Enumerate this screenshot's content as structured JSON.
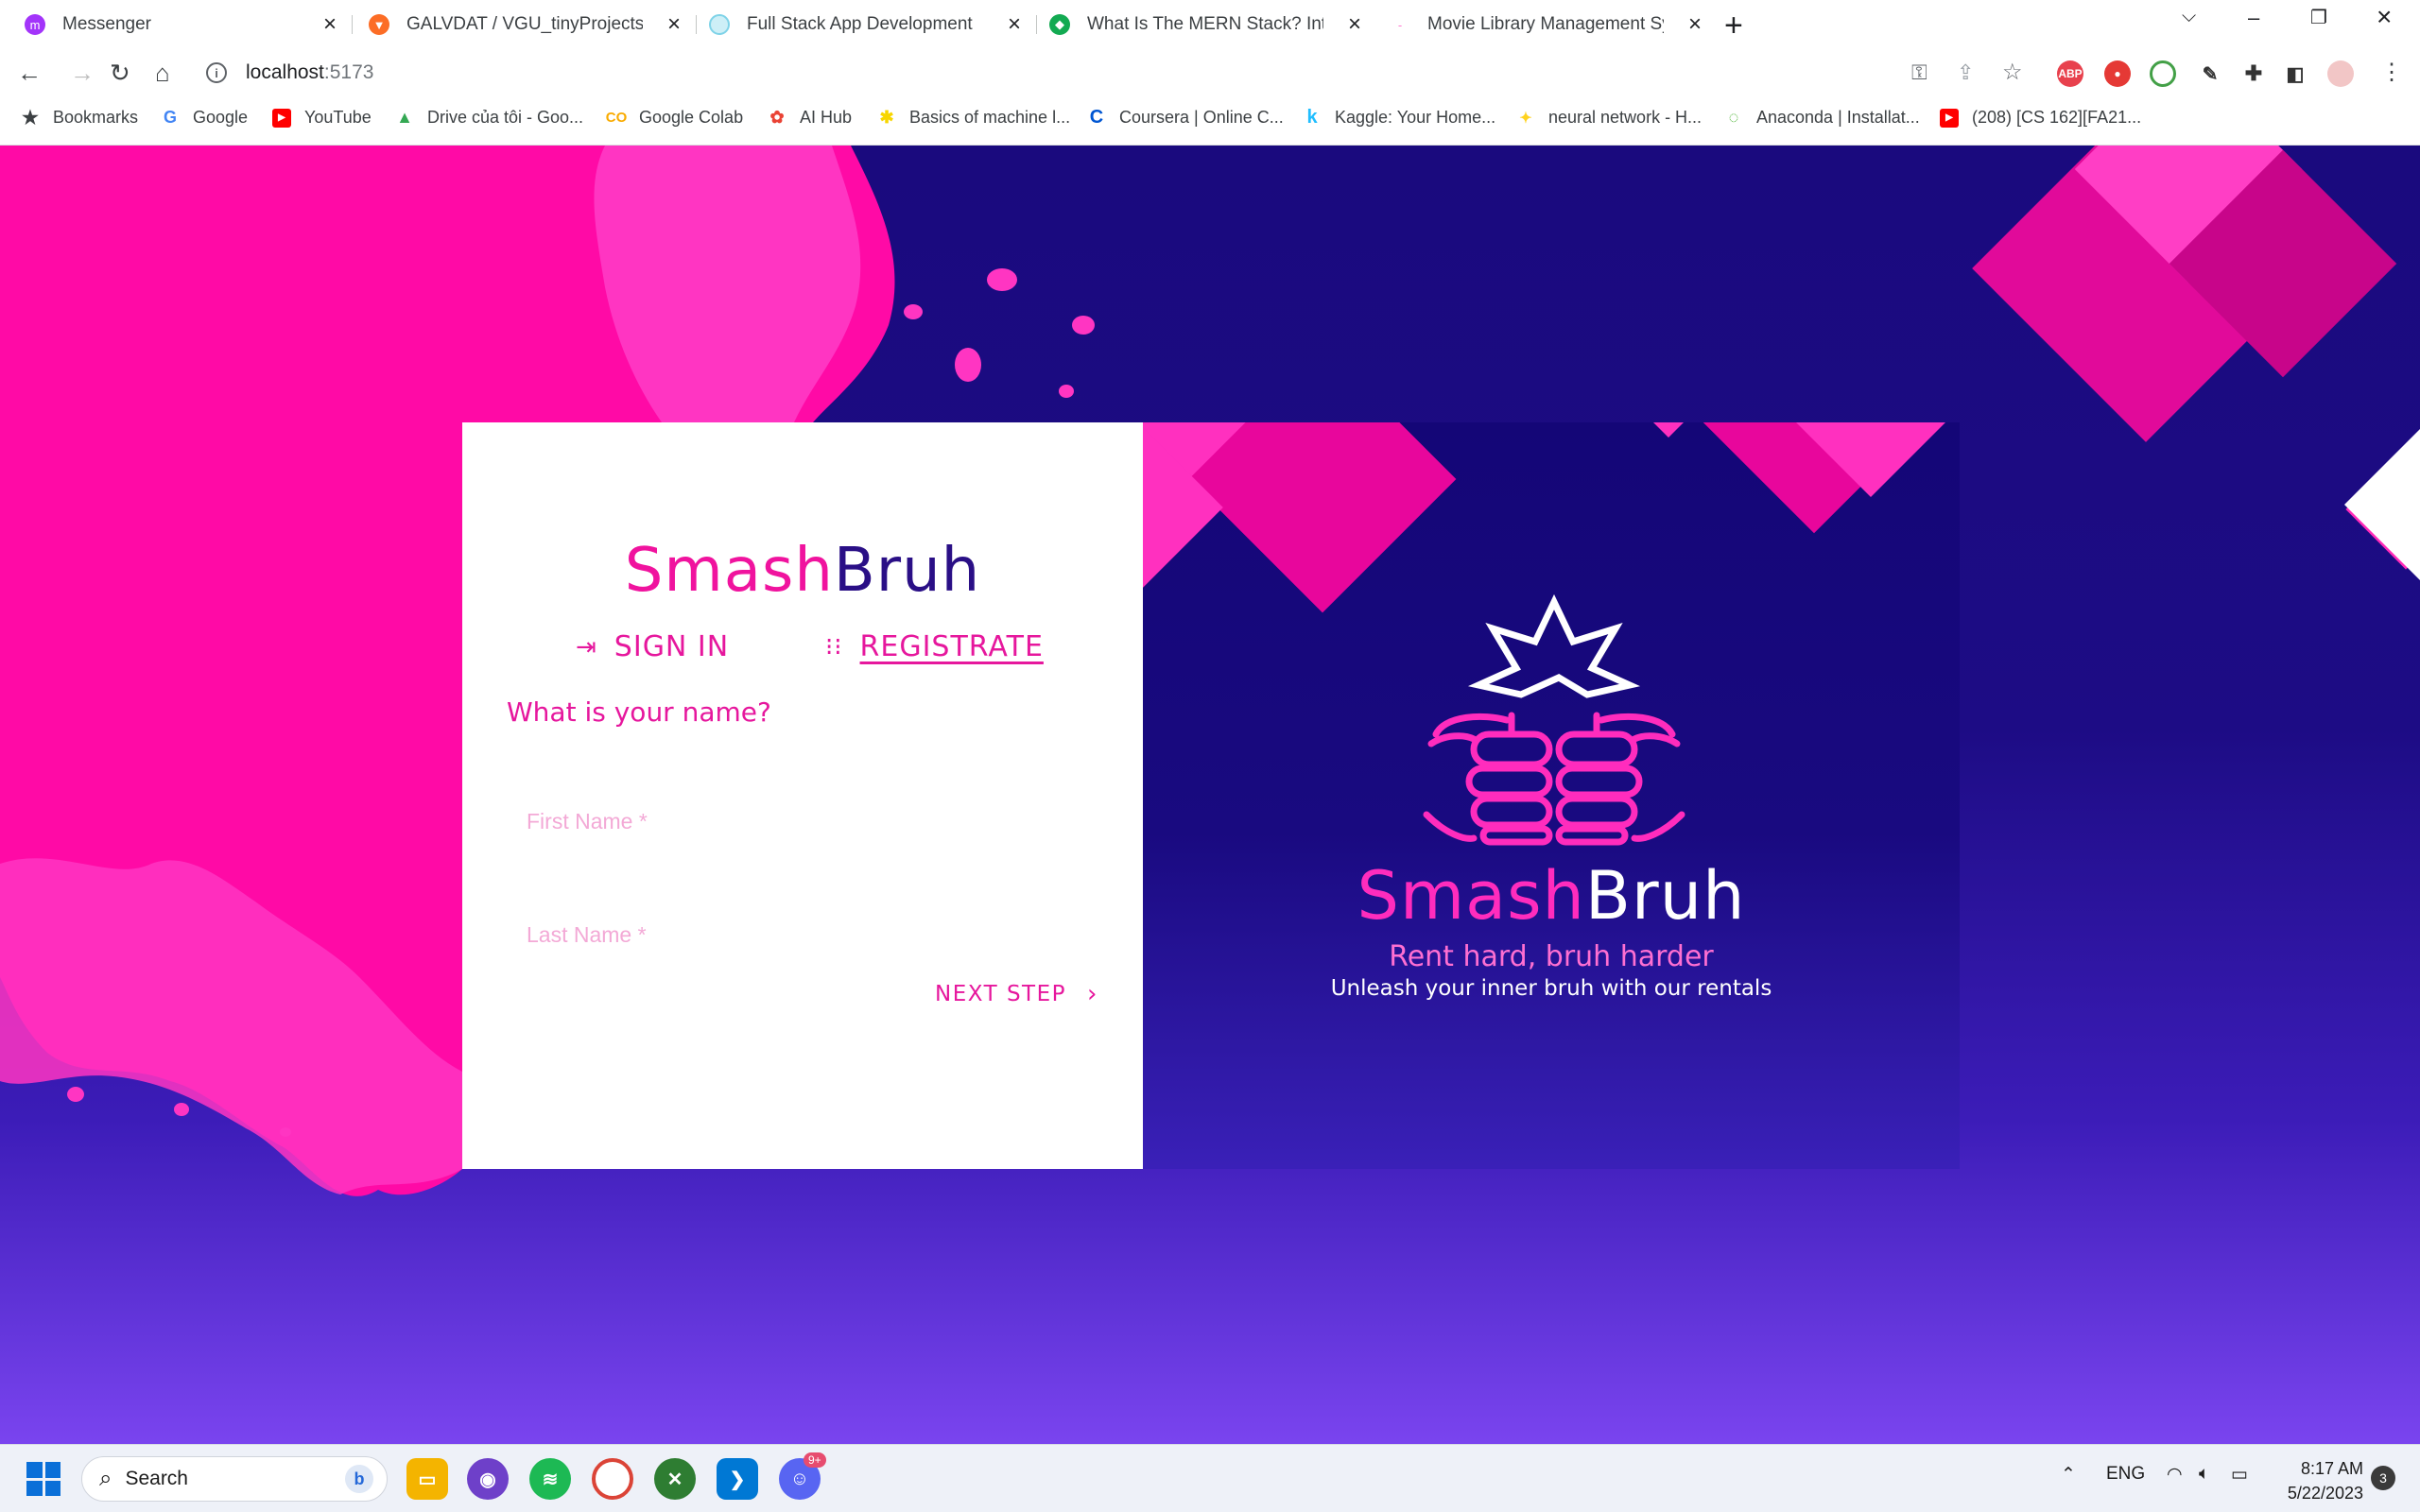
{
  "browser": {
    "tabs": [
      {
        "title": "Messenger",
        "icon": "messenger-icon",
        "color": "#a334fa"
      },
      {
        "title": "GALVDAT / VGU_tinyProjects / P",
        "icon": "gitlab-icon",
        "color": "#fc6d26"
      },
      {
        "title": "Full Stack App Development",
        "icon": "globe-icon",
        "color": "#7fd3e8"
      },
      {
        "title": "What Is The MERN Stack? Introd",
        "icon": "mongodb-icon",
        "color": "#13aa52"
      },
      {
        "title": "Movie Library Management Sys",
        "icon": "page-icon",
        "color": "#ff7ad0"
      }
    ],
    "url_host": "localhost",
    "url_port": ":5173",
    "bookmarks": [
      {
        "label": "Bookmarks",
        "icon": "star-icon"
      },
      {
        "label": "Google",
        "icon": "google-icon"
      },
      {
        "label": "YouTube",
        "icon": "youtube-icon"
      },
      {
        "label": "Drive của tôi - Goo...",
        "icon": "drive-icon"
      },
      {
        "label": "Google Colab",
        "icon": "colab-icon"
      },
      {
        "label": "AI Hub",
        "icon": "aihub-icon"
      },
      {
        "label": "Basics of machine l...",
        "icon": "ml-icon"
      },
      {
        "label": "Coursera | Online C...",
        "icon": "coursera-icon"
      },
      {
        "label": "Kaggle: Your Home...",
        "icon": "kaggle-icon"
      },
      {
        "label": "neural network - H...",
        "icon": "hf-icon"
      },
      {
        "label": "Anaconda | Installat...",
        "icon": "anaconda-icon"
      },
      {
        "label": "(208) [CS 162][FA21...",
        "icon": "youtube-icon"
      }
    ]
  },
  "app": {
    "brand_part1": "Smash",
    "brand_part2": "Bruh",
    "signin_label": "SIGN IN",
    "register_label": "REGISTRATE",
    "question": "What is your name?",
    "first_name_placeholder": "First Name *",
    "last_name_placeholder": "Last Name *",
    "next_label": "NEXT STEP",
    "tagline": "Rent hard, bruh harder",
    "subtagline": "Unleash your inner bruh with our rentals",
    "colors": {
      "pink": "#f0139e",
      "navy": "#1a0a7e",
      "purple": "#7a44ef"
    }
  },
  "taskbar": {
    "search_label": "Search",
    "lang": "ENG",
    "time": "8:17 AM",
    "date": "5/22/2023",
    "notification_count": "3",
    "discord_badge": "9+"
  }
}
